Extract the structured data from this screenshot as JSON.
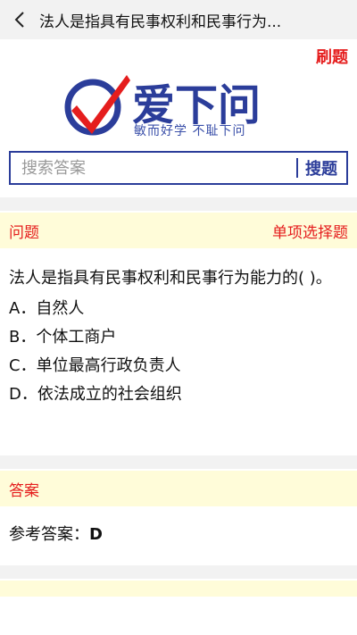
{
  "header": {
    "title": "法人是指具有民事权利和民事行为..."
  },
  "brush_label": "刷题",
  "logo": {
    "text": "爱下问",
    "slogan": "敏而好学 不耻下问"
  },
  "search": {
    "placeholder": "搜索答案",
    "button_label": "搜题"
  },
  "question_section": {
    "label": "问题",
    "type": "单项选择题"
  },
  "question": {
    "stem": "法人是指具有民事权利和民事行为能力的(  )。",
    "options": [
      "A．自然人",
      "B．个体工商户",
      "C．单位最高行政负责人",
      "D．依法成立的社会组织"
    ]
  },
  "answer_section": {
    "label": "答案"
  },
  "answer": {
    "prefix": "参考答案：",
    "value": "D"
  },
  "colors": {
    "accent_red": "#e51d1d",
    "brand_blue": "#2b3d9a",
    "header_bg": "#fffcd9",
    "gap_bg": "#f2f2f2"
  }
}
